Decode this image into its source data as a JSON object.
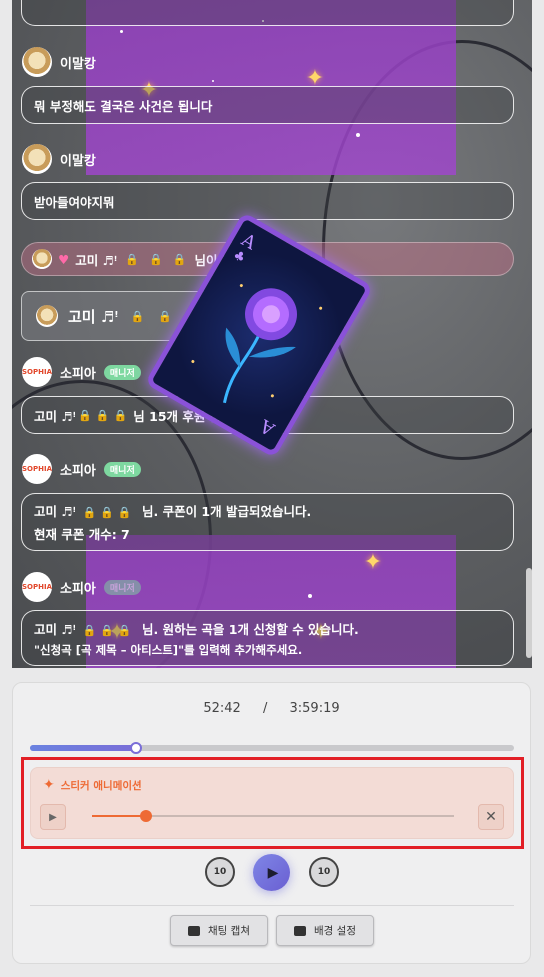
{
  "chat": {
    "messages": [
      {
        "user": "이말캉",
        "text": "뭐 부정해도 결국은 사건은 됩니다"
      },
      {
        "user": "이말캉",
        "text": "받아들여야지뭐"
      }
    ],
    "donation_line": {
      "heart": "♥",
      "name": "고미 ♬ꜝ",
      "suffix": "님이 후원해주셨습니다"
    },
    "donor_card": {
      "name": "고미 ♬ꜝ"
    },
    "sophia_messages": [
      {
        "user": "소피아",
        "badge": "매니저",
        "text": "님 15개 후원 감사합니다",
        "prefix": "고미 ♬ꜝ"
      },
      {
        "user": "소피아",
        "badge": "매니저",
        "prefix": "고미 ♬ꜝ",
        "text": "님. 쿠폰이 1개 발급되었습니다.",
        "text2": "현재 쿠폰 개수: 7"
      },
      {
        "user": "소피아",
        "badge": "매니저",
        "prefix": "고미 ♬ꜝ",
        "text": "님. 원하는 곡을 1개 신청할 수 있습니다.",
        "text2": "\"신청곡 [곡 제목 – 아티스트]\"를 입력해 추가해주세요."
      }
    ],
    "sophia_logo": "SOPHIA"
  },
  "player": {
    "current_time": "52:42",
    "separator": "/",
    "total_time": "3:59:19",
    "progress": 0.22,
    "sticker": {
      "title": "스티커 애니메이션",
      "slider_value": 0.15
    },
    "rewind_label": "10",
    "forward_label": "10",
    "capture_label": "채팅 캡쳐",
    "background_label": "배경 설정"
  },
  "colors": {
    "accent": "#ee6a34",
    "highlight": "#e21f26",
    "progress": "#6a82e0",
    "manager_badge": "#7ed8a0"
  }
}
